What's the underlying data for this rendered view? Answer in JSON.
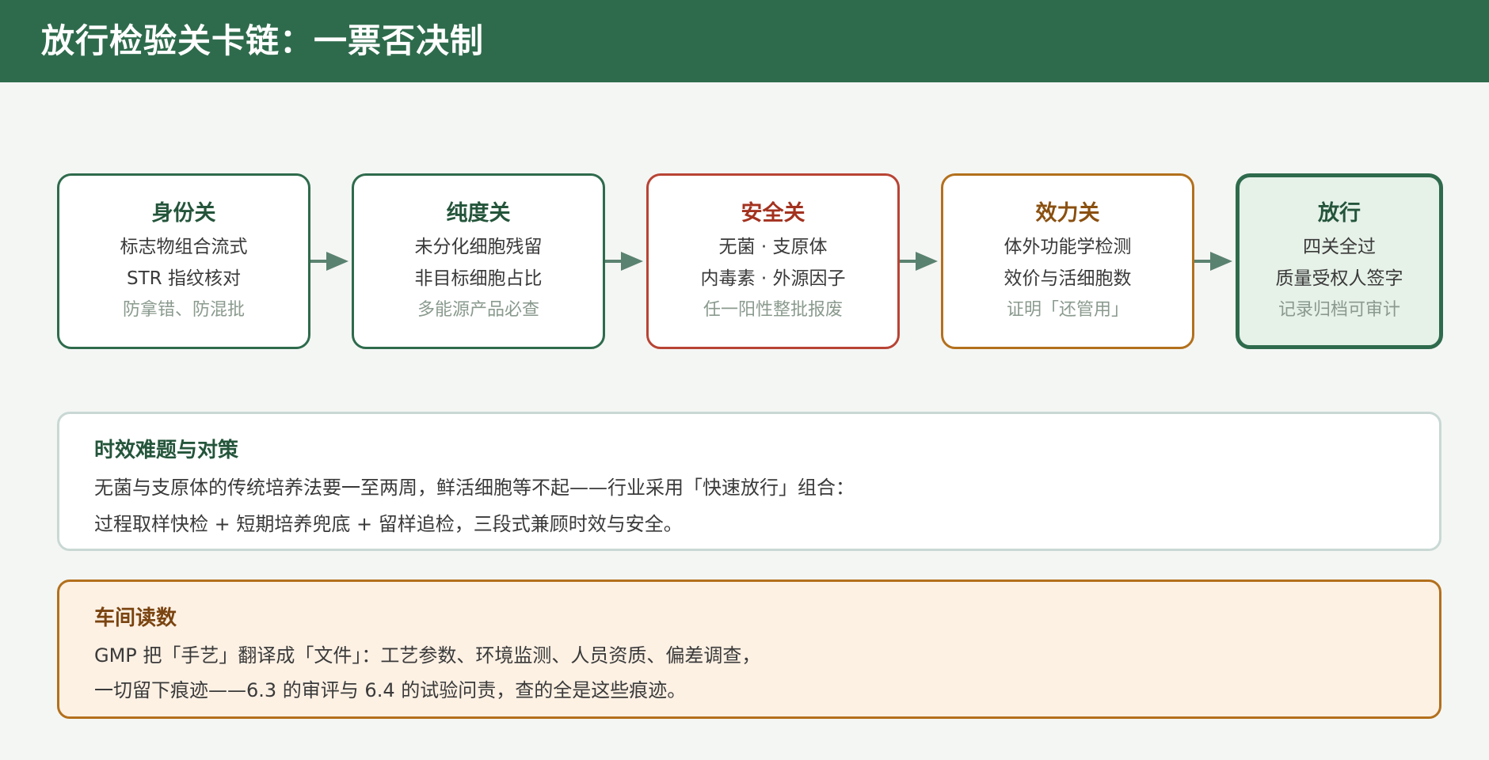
{
  "header": {
    "title": "放行检验关卡链：一票否决制"
  },
  "stages": [
    {
      "title": "身份关",
      "lines": [
        "标志物组合流式",
        "STR 指纹核对"
      ],
      "note": "防拿错、防混批"
    },
    {
      "title": "纯度关",
      "lines": [
        "未分化细胞残留",
        "非目标细胞占比"
      ],
      "note": "多能源产品必查"
    },
    {
      "title": "安全关",
      "lines": [
        "无菌 · 支原体",
        "内毒素 · 外源因子"
      ],
      "note": "任一阳性整批报废"
    },
    {
      "title": "效力关",
      "lines": [
        "体外功能学检测",
        "效价与活细胞数"
      ],
      "note": "证明「还管用」"
    },
    {
      "title": "放行",
      "lines": [
        "四关全过",
        "质量受权人签字"
      ],
      "note": "记录归档可审计"
    }
  ],
  "timing_panel": {
    "title": "时效难题与对策",
    "lines": [
      "无菌与支原体的传统培养法要一至两周，鲜活细胞等不起——行业采用「快速放行」组合：",
      "过程取样快检 + 短期培养兜底 + 留样追检，三段式兼顾时效与安全。"
    ]
  },
  "workshop_panel": {
    "title": "车间读数",
    "lines": [
      "GMP 把「手艺」翻译成「文件」：工艺参数、环境监测、人员资质、偏差调查，",
      "一切留下痕迹——6.3 的审评与 6.4 的试验问责，查的全是这些痕迹。"
    ]
  },
  "colors": {
    "header_bg": "#2e6b4c",
    "green": "#2e6b4c",
    "red": "#b84434",
    "orange": "#b3701c",
    "arrow": "#5a8270",
    "release_bg": "#e6f1e8",
    "note_bg": "#fdf1e4"
  }
}
